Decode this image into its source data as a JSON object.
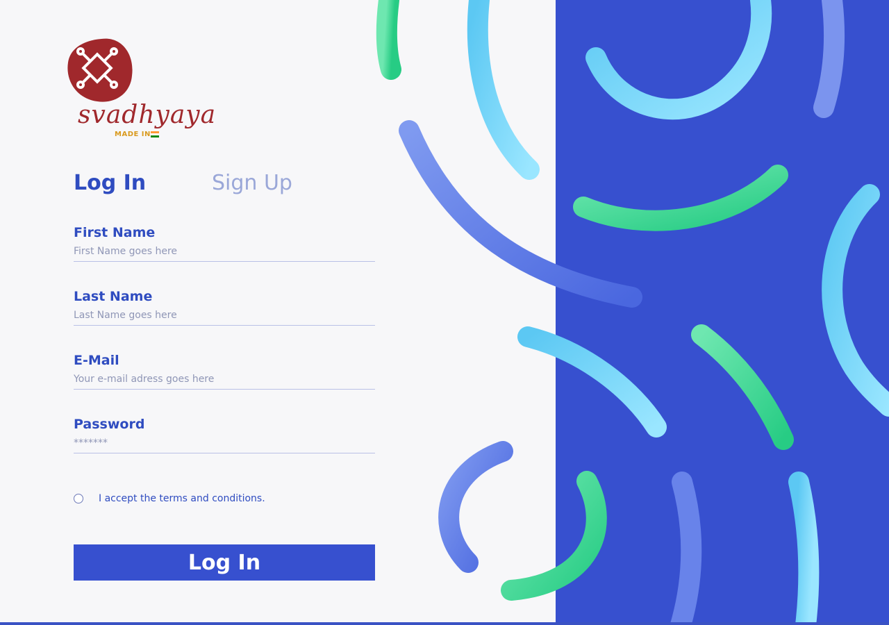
{
  "brand": {
    "wordmark": "svadhyaya",
    "tagline": "MADE IN",
    "colors": {
      "logo_red": "#a0282c",
      "accent_blue": "#3750cf",
      "tagline_gold": "#d99a1e"
    }
  },
  "tabs": [
    {
      "label": "Log In",
      "active": true
    },
    {
      "label": "Sign Up",
      "active": false
    }
  ],
  "form": {
    "first_name": {
      "label": "First Name",
      "placeholder": "First Name goes here",
      "value": ""
    },
    "last_name": {
      "label": "Last Name",
      "placeholder": "Last Name goes here",
      "value": ""
    },
    "email": {
      "label": "E-Mail",
      "placeholder": "Your e-mail adress goes here",
      "value": ""
    },
    "password": {
      "label": "Password",
      "placeholder": "*******",
      "value": ""
    },
    "terms": {
      "label": "I accept the terms and conditions.",
      "checked": false
    },
    "submit_label": "Log In"
  }
}
